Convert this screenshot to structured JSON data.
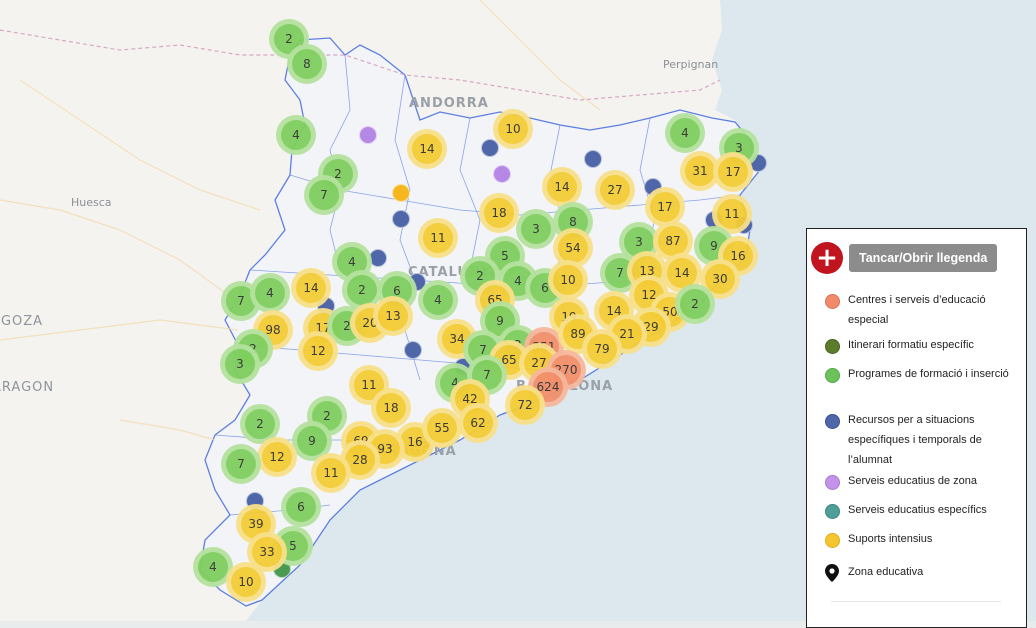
{
  "map": {
    "place_labels": [
      "Perpignan",
      "Huesca",
      "ANDORRA",
      "CATALUNYA",
      "ZARAGOZA",
      "ARAGON",
      "BARCELONA",
      "TARRAGONA"
    ],
    "colors": {
      "sea": "#dce8ee",
      "land": "#f4f3ef",
      "catalonia": "#f2f3f7",
      "boundary": "#5d7fe0",
      "green": "#7fcf5f",
      "green_halo": "#b4e29e",
      "yellow": "#f4cc35",
      "yellow_halo": "#f8e08a",
      "orange": "#f28f6a",
      "orange_halo": "#f6b79c"
    }
  },
  "clusters": [
    {
      "label": "2",
      "color": "green"
    },
    {
      "label": "8",
      "color": "green"
    },
    {
      "label": "4",
      "color": "green"
    },
    {
      "label": "2",
      "color": "green"
    },
    {
      "label": "7",
      "color": "green"
    },
    {
      "label": "14",
      "color": "yellow"
    },
    {
      "label": "10",
      "color": "yellow"
    },
    {
      "label": "4",
      "color": "green"
    },
    {
      "label": "3",
      "color": "green"
    },
    {
      "label": "31",
      "color": "yellow"
    },
    {
      "label": "17",
      "color": "yellow"
    },
    {
      "label": "14",
      "color": "yellow"
    },
    {
      "label": "27",
      "color": "yellow"
    },
    {
      "label": "17",
      "color": "yellow"
    },
    {
      "label": "11",
      "color": "yellow"
    },
    {
      "label": "18",
      "color": "yellow"
    },
    {
      "label": "3",
      "color": "green"
    },
    {
      "label": "8",
      "color": "green"
    },
    {
      "label": "11",
      "color": "yellow"
    },
    {
      "label": "54",
      "color": "yellow"
    },
    {
      "label": "3",
      "color": "green"
    },
    {
      "label": "87",
      "color": "yellow"
    },
    {
      "label": "9",
      "color": "green"
    },
    {
      "label": "16",
      "color": "yellow"
    },
    {
      "label": "4",
      "color": "green"
    },
    {
      "label": "5",
      "color": "green"
    },
    {
      "label": "2",
      "color": "green"
    },
    {
      "label": "4",
      "color": "green"
    },
    {
      "label": "6",
      "color": "green"
    },
    {
      "label": "10",
      "color": "yellow"
    },
    {
      "label": "7",
      "color": "green"
    },
    {
      "label": "13",
      "color": "yellow"
    },
    {
      "label": "14",
      "color": "yellow"
    },
    {
      "label": "30",
      "color": "yellow"
    },
    {
      "label": "7",
      "color": "green"
    },
    {
      "label": "4",
      "color": "green"
    },
    {
      "label": "14",
      "color": "yellow"
    },
    {
      "label": "2",
      "color": "green"
    },
    {
      "label": "6",
      "color": "green"
    },
    {
      "label": "4",
      "color": "green"
    },
    {
      "label": "65",
      "color": "yellow"
    },
    {
      "label": "12",
      "color": "yellow"
    },
    {
      "label": "50",
      "color": "yellow"
    },
    {
      "label": "2",
      "color": "green"
    },
    {
      "label": "98",
      "color": "yellow"
    },
    {
      "label": "17",
      "color": "yellow"
    },
    {
      "label": "2",
      "color": "green"
    },
    {
      "label": "20",
      "color": "yellow"
    },
    {
      "label": "13",
      "color": "yellow"
    },
    {
      "label": "9",
      "color": "green"
    },
    {
      "label": "19",
      "color": "yellow"
    },
    {
      "label": "14",
      "color": "yellow"
    },
    {
      "label": "29",
      "color": "yellow"
    },
    {
      "label": "2",
      "color": "green"
    },
    {
      "label": "3",
      "color": "green"
    },
    {
      "label": "12",
      "color": "yellow"
    },
    {
      "label": "34",
      "color": "yellow"
    },
    {
      "label": "7",
      "color": "green"
    },
    {
      "label": "2",
      "color": "green"
    },
    {
      "label": "351",
      "color": "orange"
    },
    {
      "label": "89",
      "color": "yellow"
    },
    {
      "label": "21",
      "color": "yellow"
    },
    {
      "label": "79",
      "color": "yellow"
    },
    {
      "label": "65",
      "color": "yellow"
    },
    {
      "label": "27",
      "color": "yellow"
    },
    {
      "label": "270",
      "color": "orange"
    },
    {
      "label": "11",
      "color": "yellow"
    },
    {
      "label": "4",
      "color": "green"
    },
    {
      "label": "7",
      "color": "green"
    },
    {
      "label": "624",
      "color": "orange"
    },
    {
      "label": "42",
      "color": "yellow"
    },
    {
      "label": "72",
      "color": "yellow"
    },
    {
      "label": "2",
      "color": "green"
    },
    {
      "label": "2",
      "color": "green"
    },
    {
      "label": "18",
      "color": "yellow"
    },
    {
      "label": "9",
      "color": "green"
    },
    {
      "label": "69",
      "color": "yellow"
    },
    {
      "label": "16",
      "color": "yellow"
    },
    {
      "label": "55",
      "color": "yellow"
    },
    {
      "label": "62",
      "color": "yellow"
    },
    {
      "label": "93",
      "color": "yellow"
    },
    {
      "label": "28",
      "color": "yellow"
    },
    {
      "label": "12",
      "color": "yellow"
    },
    {
      "label": "7",
      "color": "green"
    },
    {
      "label": "11",
      "color": "yellow"
    },
    {
      "label": "6",
      "color": "green"
    },
    {
      "label": "39",
      "color": "yellow"
    },
    {
      "label": "5",
      "color": "green"
    },
    {
      "label": "33",
      "color": "yellow"
    },
    {
      "label": "4",
      "color": "green"
    },
    {
      "label": "10",
      "color": "yellow"
    }
  ],
  "dots": [
    {
      "color": "#b688e6"
    },
    {
      "color": "#b688e6"
    },
    {
      "color": "#f6b71e"
    },
    {
      "color": "#4f66a9"
    },
    {
      "color": "#4f66a9"
    },
    {
      "color": "#4f66a9"
    },
    {
      "color": "#4f66a9"
    },
    {
      "color": "#4f66a9"
    },
    {
      "color": "#4f66a9"
    },
    {
      "color": "#4f66a9"
    },
    {
      "color": "#4f66a9"
    },
    {
      "color": "#4f66a9"
    },
    {
      "color": "#4f66a9"
    },
    {
      "color": "#4f66a9"
    },
    {
      "color": "#4f66a9"
    },
    {
      "color": "#4f66a9"
    },
    {
      "color": "#4a9a52"
    }
  ],
  "legend": {
    "toggle_icon": "plus-icon",
    "toggle_label": "Tancar/Obrir llegenda",
    "items": [
      {
        "label": "Centres i serveis d’educació especial",
        "color": "#f08a6a"
      },
      {
        "label": "Itinerari formatiu específic",
        "color": "#5b7d2b"
      },
      {
        "label": "Programes de formació i inserció",
        "color": "#6bc25a"
      },
      {
        "label": "Recursos per a situacions específiques i temporals de l’alumnat",
        "color": "#4f66a9"
      },
      {
        "label": "Serveis educatius de zona",
        "color": "#c393ea"
      },
      {
        "label": "Serveis educatius específics",
        "color": "#4f9e9a"
      },
      {
        "label": "Suports intensius",
        "color": "#f5c631"
      },
      {
        "label": "Zona educativa",
        "icon": "map-pin-icon"
      }
    ]
  }
}
